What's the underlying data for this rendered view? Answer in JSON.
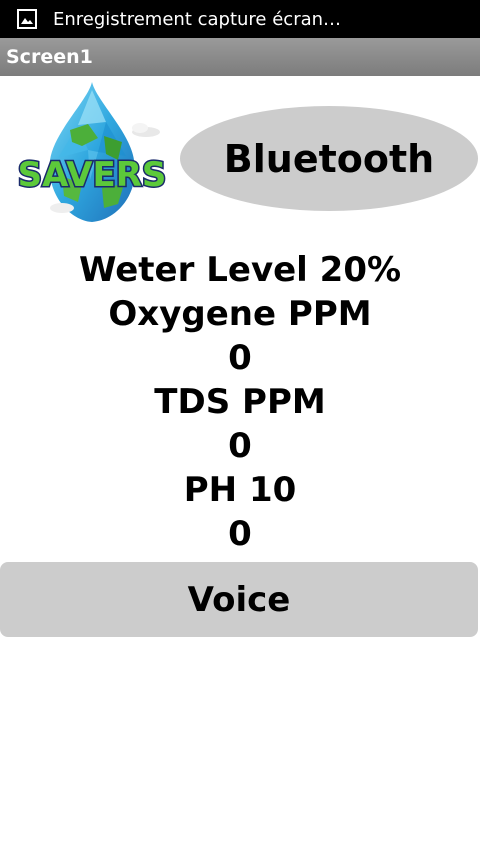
{
  "status_bar": {
    "notification_icon": "image-icon",
    "notification_text": "Enregistrement capture écran…"
  },
  "title_bar": {
    "title": "Screen1"
  },
  "logo": {
    "text": "SAVERS"
  },
  "bluetooth_button": {
    "label": "Bluetooth"
  },
  "readings": {
    "water_level_label": "Weter Level 20%",
    "oxygen_label": "Oxygene PPM",
    "oxygen_value": "0",
    "tds_label": "TDS PPM",
    "tds_value": "0",
    "ph_label": "PH 10",
    "ph_value": "0"
  },
  "voice_button": {
    "label": "Voice"
  },
  "colors": {
    "status_bar": "#000000",
    "title_bar": "#8a8a8a",
    "button_gray": "#cccccc",
    "logo_blue": "#2fa7df",
    "logo_green": "#5cc93a"
  }
}
